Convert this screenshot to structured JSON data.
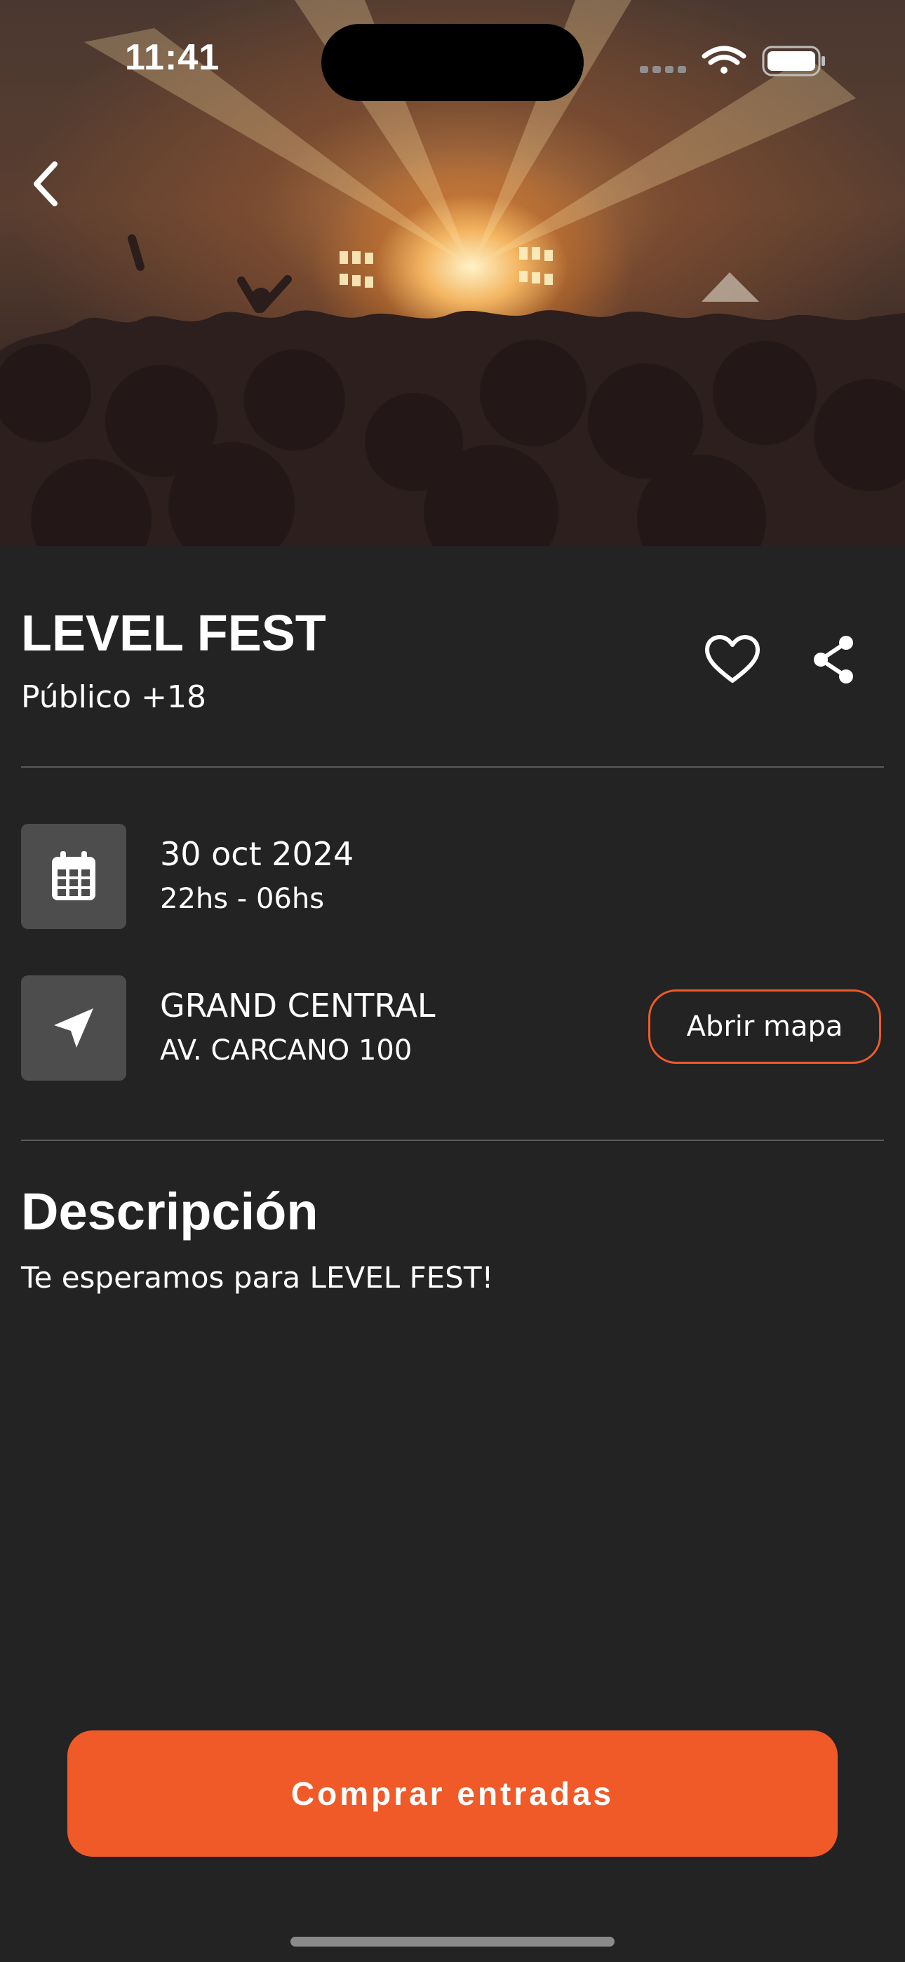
{
  "status_bar": {
    "time": "11:41"
  },
  "event": {
    "title": "LEVEL FEST",
    "audience": "Público +18"
  },
  "schedule": {
    "date": "30 oct 2024",
    "hours": "22hs - 06hs"
  },
  "venue": {
    "name": "GRAND CENTRAL",
    "address": "AV. CARCANO 100",
    "map_button": "Abrir mapa"
  },
  "description": {
    "heading": "Descripción",
    "text": "Te esperamos para LEVEL FEST!"
  },
  "cta": {
    "label": "Comprar entradas"
  },
  "colors": {
    "accent": "#f05a28",
    "background": "#232323",
    "tile": "#4d4d4d"
  },
  "icons": [
    "back-arrow-icon",
    "heart-icon",
    "share-icon",
    "calendar-icon",
    "navigation-arrow-icon",
    "wifi-icon",
    "battery-icon",
    "cellular-signal-icon"
  ]
}
